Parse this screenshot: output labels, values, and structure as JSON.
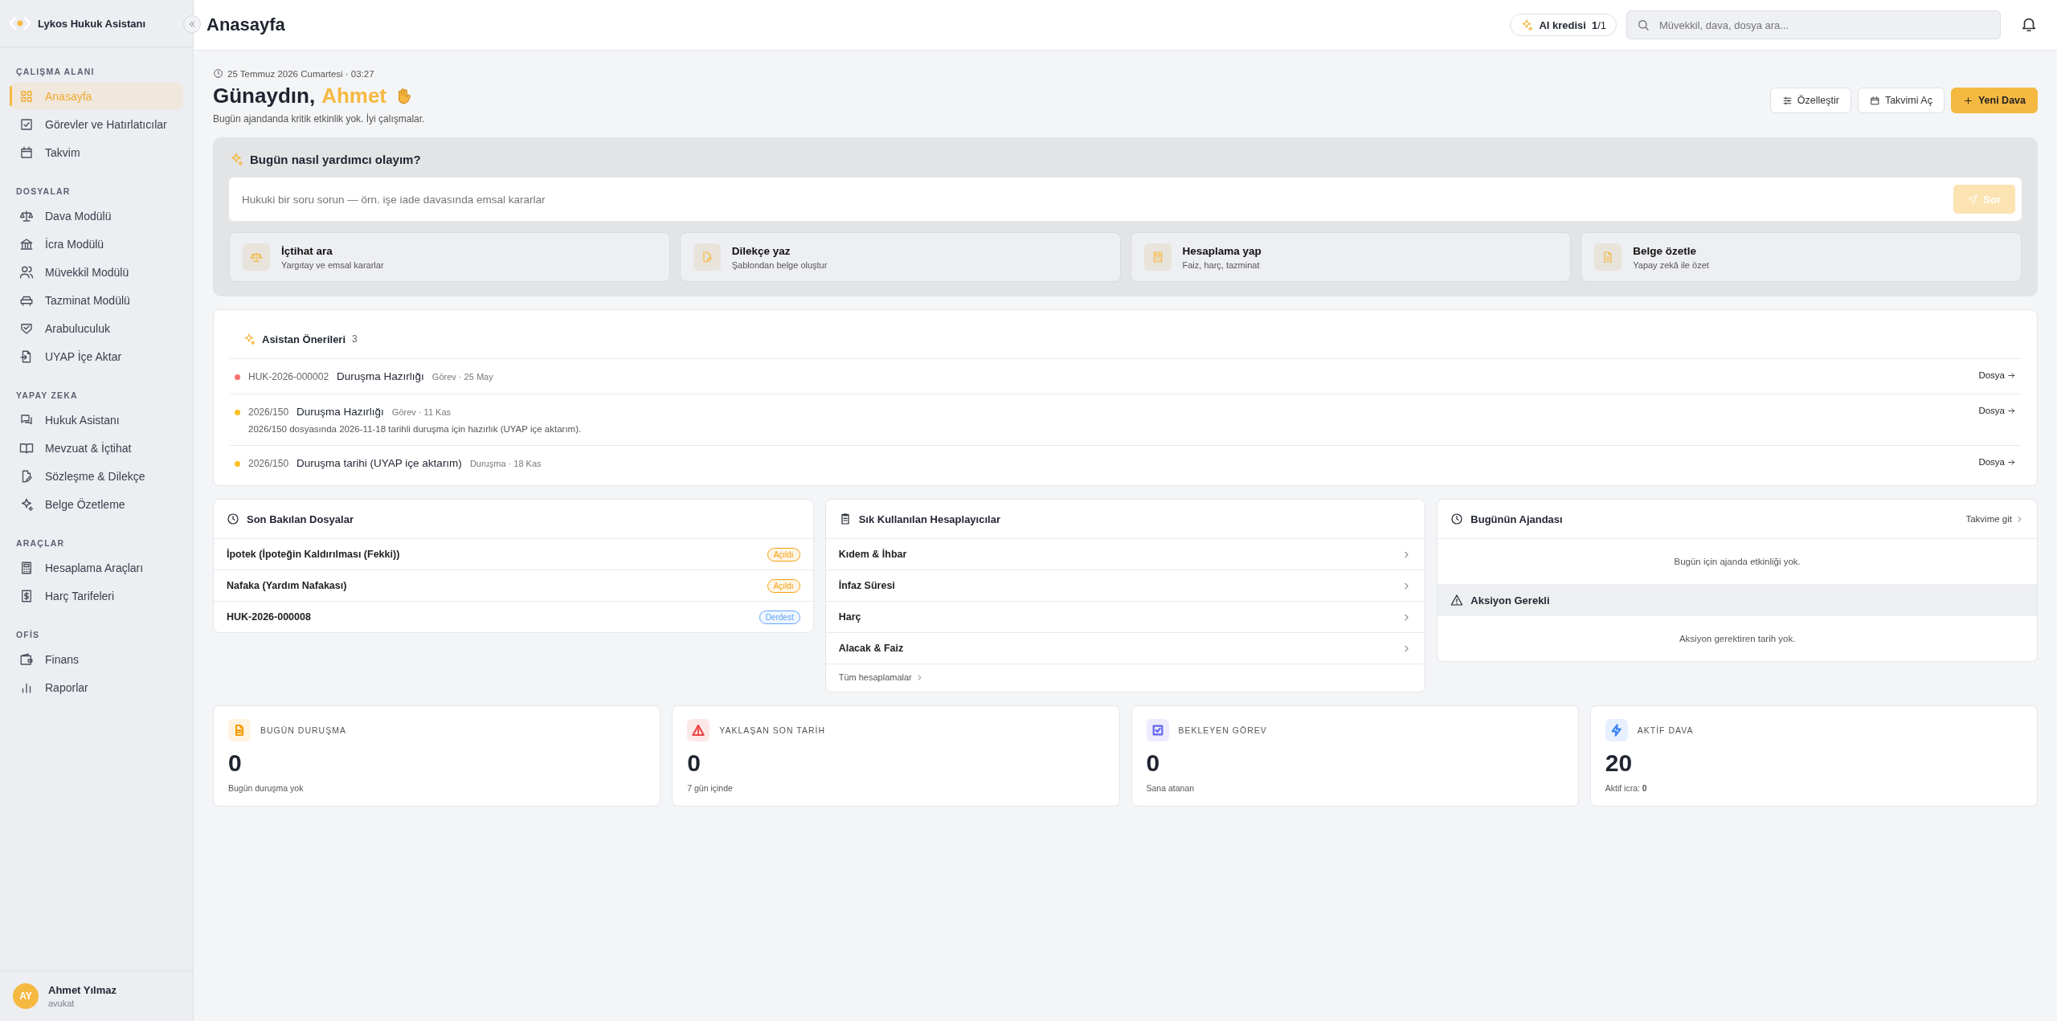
{
  "app": {
    "name": "Lykos Hukuk Asistanı"
  },
  "sidebar": {
    "sections": [
      {
        "title": "ÇALIŞMA ALANI",
        "items": [
          {
            "label": "Anasayfa",
            "selected": true
          },
          {
            "label": "Görevler ve Hatırlatıcılar",
            "selected": false
          },
          {
            "label": "Takvim",
            "selected": false
          }
        ]
      },
      {
        "title": "DOSYALAR",
        "items": [
          {
            "label": "Dava Modülü",
            "selected": false
          },
          {
            "label": "İcra Modülü",
            "selected": false
          },
          {
            "label": "Müvekkil Modülü",
            "selected": false
          },
          {
            "label": "Tazminat Modülü",
            "selected": false
          },
          {
            "label": "Arabuluculuk",
            "selected": false
          },
          {
            "label": "UYAP İçe Aktar",
            "selected": false
          }
        ]
      },
      {
        "title": "YAPAY ZEKA",
        "items": [
          {
            "label": "Hukuk Asistanı",
            "selected": false
          },
          {
            "label": "Mevzuat & İçtihat",
            "selected": false
          },
          {
            "label": "Sözleşme & Dilekçe",
            "selected": false
          },
          {
            "label": "Belge Özetleme",
            "selected": false
          }
        ]
      },
      {
        "title": "ARAÇLAR",
        "items": [
          {
            "label": "Hesaplama Araçları",
            "selected": false
          },
          {
            "label": "Harç Tarifeleri",
            "selected": false
          }
        ]
      },
      {
        "title": "OFİS",
        "items": [
          {
            "label": "Finans",
            "selected": false
          },
          {
            "label": "Raporlar",
            "selected": false
          }
        ]
      }
    ],
    "user": {
      "initials": "AY",
      "name": "Ahmet Yılmaz",
      "role": "avukat"
    }
  },
  "header": {
    "title": "Anasayfa",
    "ai_credit": {
      "label": "AI kredisi",
      "value": "**1**/1"
    },
    "search": {
      "placeholder": "Müvekkil, dava, dosya ara..."
    }
  },
  "greeting": {
    "date": "25 Temmuz 2026 Cumartesi · 03:27",
    "hello": "Günaydın,",
    "name": "Ahmet",
    "subtitle": "Bugün ajandanda kritik etkinlik yok. İyi çalışmalar."
  },
  "actions": [
    {
      "label": "Özelleştir",
      "kind": "outline"
    },
    {
      "label": "Takvimi Aç",
      "kind": "outline"
    },
    {
      "label": "Yeni Dava",
      "kind": "primary"
    }
  ],
  "assistant": {
    "title": "Bugün nasıl yardımcı olayım?",
    "input": {
      "placeholder": "Hukuki bir soru sorun — örn. işe iade davasında emsal kararlar"
    },
    "ask_button": {
      "label": "Sor",
      "disabled": true
    },
    "quick_actions": [
      {
        "title": "İçtihat ara",
        "subtitle": "Yargıtay ve emsal kararlar"
      },
      {
        "title": "Dilekçe yaz",
        "subtitle": "Şablondan belge oluştur"
      },
      {
        "title": "Hesaplama yap",
        "subtitle": "Faiz, harç, tazminat"
      },
      {
        "title": "Belge özetle",
        "subtitle": "Yapay zekâ ile özet"
      }
    ]
  },
  "suggestions": {
    "title": "Asistan Önerileri",
    "count": "3",
    "items": [
      {
        "color": "#f87171",
        "ref": "HUK-2026-000002",
        "title": "Duruşma Hazırlığı",
        "meta": "Görev · 25 May",
        "link": "Dosya"
      },
      {
        "color": "#fbbf24",
        "ref": "2026/150",
        "title": "Duruşma Hazırlığı",
        "meta": "Görev · 11 Kas",
        "detail": "2026/150 dosyasında 2026-11-18 tarihli duruşma için hazırlık (UYAP içe aktarım).",
        "link": "Dosya"
      },
      {
        "color": "#fbbf24",
        "ref": "2026/150",
        "title": "Duruşma tarihi (UYAP içe aktarım)",
        "meta": "Duruşma · 18 Kas",
        "link": "Dosya"
      }
    ]
  },
  "recent_files": {
    "title": "Son Bakılan Dosyalar",
    "rows": [
      {
        "name": "İpotek (İpoteğin Kaldırılması (Fekki))",
        "badge": {
          "label": "Açıldı",
          "color": "#f59e0b"
        }
      },
      {
        "name": "Nafaka (Yardım Nafakası)",
        "badge": {
          "label": "Açıldı",
          "color": "#f59e0b"
        }
      },
      {
        "name": "HUK-2026-000008",
        "badge": {
          "label": "Derdest",
          "color": "#60a5fa"
        }
      }
    ]
  },
  "calculators": {
    "title": "Sık Kullanılan Hesaplayıcılar",
    "items": [
      "Kıdem & İhbar",
      "İnfaz Süresi",
      "Harç",
      "Alacak & Faiz"
    ],
    "footer_link": "Tüm hesaplamalar"
  },
  "agenda": {
    "title": "Bugünün Ajandası",
    "link": "Takvime git",
    "empty": "Bugün için ajanda etkinliği yok.",
    "action_required": {
      "title": "Aksiyon Gerekli",
      "empty": "Aksiyon gerektiren tarih yok."
    }
  },
  "stats": [
    {
      "label": "BUGÜN DURUŞMA",
      "value": "0",
      "note": "Bugün duruşma yok",
      "color": "#f59e0b"
    },
    {
      "label": "YAKLAŞAN SON TARİH",
      "value": "0",
      "note": "7 gün içinde",
      "color": "#ef4444"
    },
    {
      "label": "BEKLEYEN GÖREV",
      "value": "0",
      "note": "Sana atanan",
      "color": "#6366f1"
    },
    {
      "label": "AKTİF DAVA",
      "value": "20",
      "note": "Aktif icra: **0**",
      "color": "#3b82f6"
    }
  ]
}
